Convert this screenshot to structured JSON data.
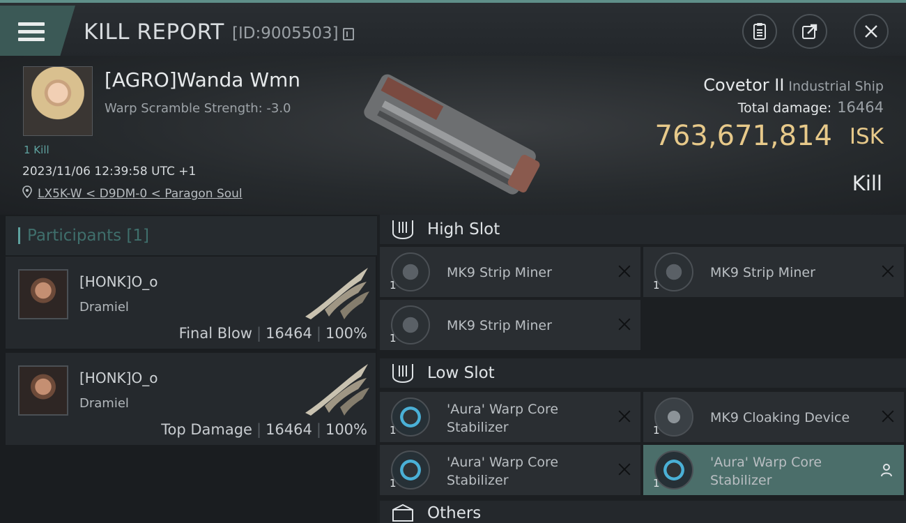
{
  "header": {
    "title": "KILL REPORT",
    "report_id": "[ID:9005503]"
  },
  "victim": {
    "name": "[AGRO]Wanda Wmn",
    "warp_scramble": "Warp Scramble Strength: -3.0",
    "kills": "1 Kill",
    "timestamp": "2023/11/06 12:39:58 UTC +1",
    "location": "LX5K-W < D9DM-0 < Paragon Soul",
    "ship_name": "Covetor II",
    "ship_class": "Industrial Ship",
    "total_damage_label": "Total damage:",
    "total_damage": "16464",
    "isk_value": "763,671,814",
    "isk_unit": "ISK",
    "result": "Kill"
  },
  "participants": {
    "heading": "Participants [1]",
    "list": [
      {
        "name": "[HONK]O_o",
        "corp": "Dramiel",
        "role": "Final Blow",
        "damage": "16464",
        "percent": "100%"
      },
      {
        "name": "[HONK]O_o",
        "corp": "Dramiel",
        "role": "Top Damage",
        "damage": "16464",
        "percent": "100%"
      }
    ]
  },
  "slots": {
    "high": {
      "label": "High Slot",
      "modules": [
        {
          "name": "MK9 Strip Miner",
          "qty": "1",
          "icon": "strip-miner-icon"
        },
        {
          "name": "MK9 Strip Miner",
          "qty": "1",
          "icon": "strip-miner-icon"
        },
        {
          "name": "MK9 Strip Miner",
          "qty": "1",
          "icon": "strip-miner-icon"
        }
      ]
    },
    "low": {
      "label": "Low Slot",
      "modules": [
        {
          "name": "'Aura' Warp Core Stabilizer",
          "qty": "1",
          "icon": "warp-core-stabilizer-icon"
        },
        {
          "name": "MK9 Cloaking Device",
          "qty": "1",
          "icon": "cloaking-device-icon"
        },
        {
          "name": "'Aura' Warp Core Stabilizer",
          "qty": "1",
          "icon": "warp-core-stabilizer-icon"
        },
        {
          "name": "'Aura' Warp Core Stabilizer",
          "qty": "1",
          "icon": "warp-core-stabilizer-icon"
        }
      ]
    },
    "others": {
      "label": "Others"
    }
  },
  "colors": {
    "accent_teal": "#5fa3a0",
    "isk_gold": "#e7c98a",
    "active_module": "#4b6e6a"
  }
}
